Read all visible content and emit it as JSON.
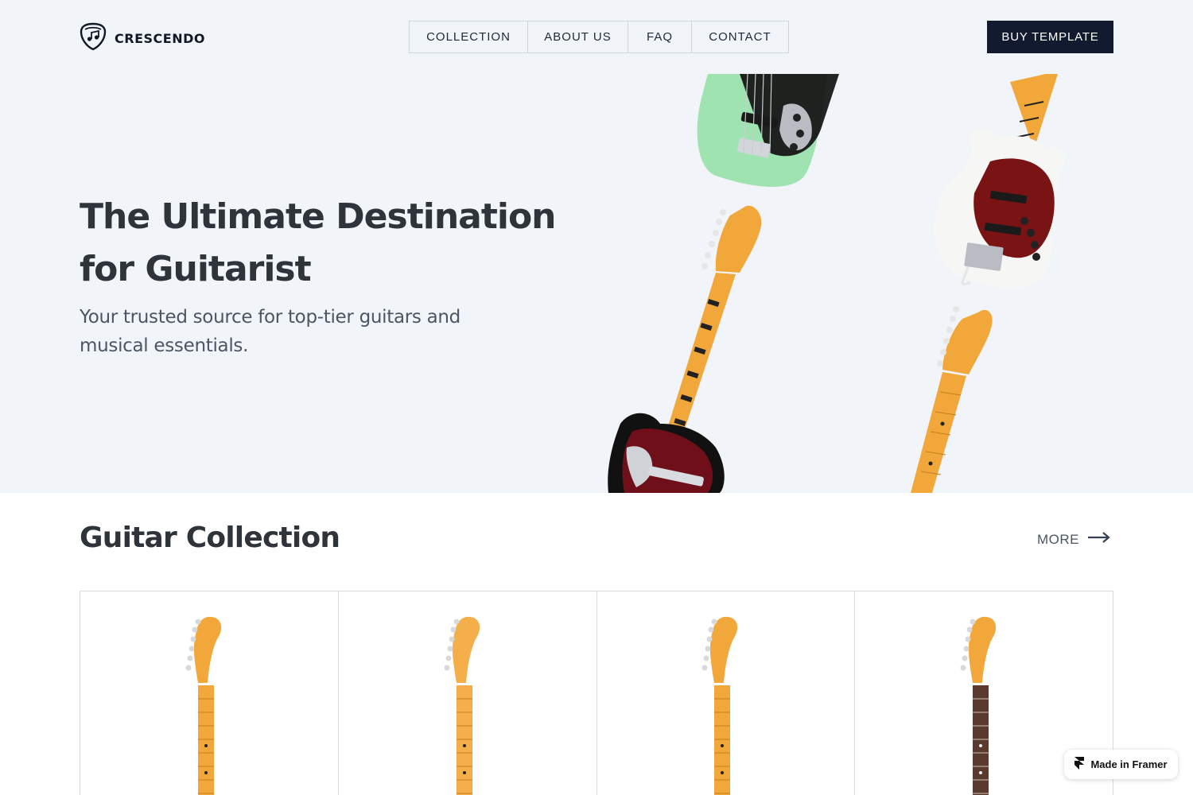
{
  "brand": {
    "name": "CRESCENDO",
    "logo_icon": "guitar-pick-note-icon"
  },
  "nav": {
    "items": [
      {
        "label": "COLLECTION"
      },
      {
        "label": "ABOUT US"
      },
      {
        "label": "FAQ"
      },
      {
        "label": "CONTACT"
      }
    ]
  },
  "header": {
    "cta_label": "BUY TEMPLATE"
  },
  "hero": {
    "title": "The Ultimate Destination for Guitarist",
    "subtitle": "Your trusted source for top-tier guitars and musical essentials."
  },
  "collection": {
    "title": "Guitar Collection",
    "more_label": "MORE",
    "more_icon": "arrow-right-icon",
    "cards": [
      {
        "fretboard": "maple"
      },
      {
        "fretboard": "maple"
      },
      {
        "fretboard": "maple"
      },
      {
        "fretboard": "rosewood"
      }
    ]
  },
  "badge": {
    "label": "Made in Framer",
    "icon": "framer-logo-icon"
  },
  "colors": {
    "hero_bg": "#f1f4f9",
    "cta_bg": "#111a2e",
    "heading": "#2f343b",
    "maple": "#f2a73a",
    "rosewood": "#5a3a2c",
    "bass_green": "#9fe3b0",
    "tortoise_red": "#7a1414"
  }
}
